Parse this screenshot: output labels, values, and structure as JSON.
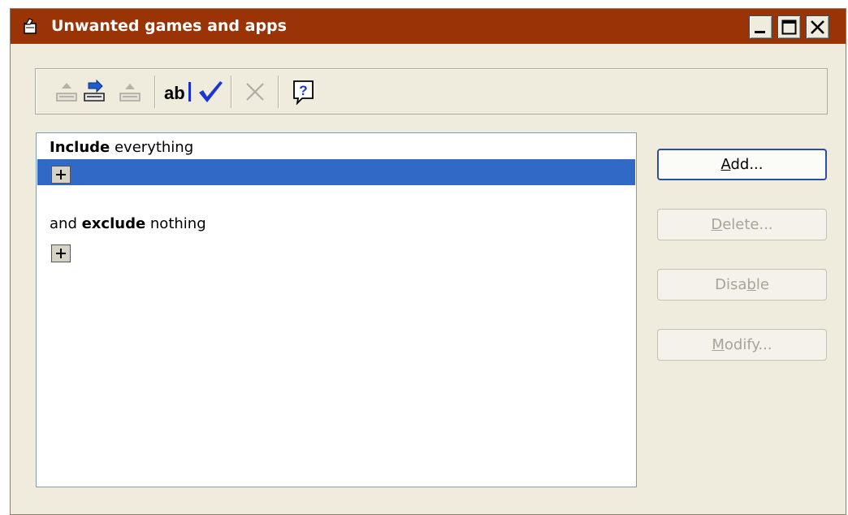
{
  "window": {
    "title": "Unwanted games and apps",
    "controls": [
      "minimize-icon",
      "maximize-icon",
      "close-icon"
    ]
  },
  "toolbar": {
    "tools": [
      {
        "icon": "move-up-icon",
        "enabled": false
      },
      {
        "icon": "move-down-icon",
        "enabled": true
      },
      {
        "icon": "move-top-icon",
        "enabled": false
      },
      {
        "icon": "rename-icon",
        "text": "ab",
        "enabled": true
      },
      {
        "icon": "checkmark-icon",
        "enabled": true
      },
      {
        "icon": "delete-x-icon",
        "enabled": false
      },
      {
        "icon": "help-icon",
        "text": "?",
        "enabled": true
      }
    ]
  },
  "rules": {
    "include": {
      "keyword": "Include",
      "rest": " everything"
    },
    "exclude": {
      "lead": "and ",
      "keyword": "exclude",
      "rest": " nothing"
    }
  },
  "buttons": {
    "add": {
      "pre": "",
      "u": "A",
      "post": "dd...",
      "enabled": true
    },
    "delete": {
      "pre": "",
      "u": "D",
      "post": "elete...",
      "enabled": false
    },
    "disable": {
      "pre": "Disa",
      "u": "b",
      "post": "le",
      "enabled": false
    },
    "modify": {
      "pre": "",
      "u": "M",
      "post": "odify...",
      "enabled": false
    }
  },
  "colors": {
    "titlebar": "#9a3306",
    "selection": "#3169c6",
    "window_bg": "#efebdd"
  }
}
